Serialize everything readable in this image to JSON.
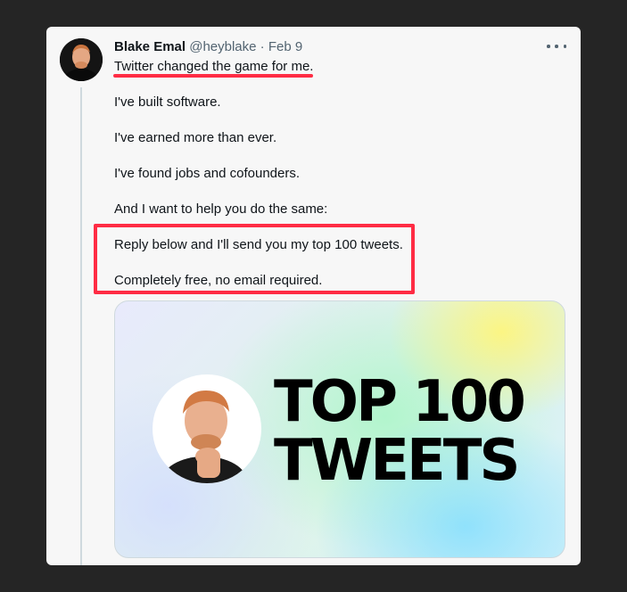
{
  "tweet": {
    "author_name": "Blake Emal",
    "handle": "@heyblake",
    "separator": "·",
    "date": "Feb 9",
    "lines": [
      "Twitter changed the game for me.",
      "I've built software.",
      "I've earned more than ever.",
      "I've found jobs and cofounders.",
      "And I want to help you do the same:",
      "Reply below and I'll send you my top 100 tweets.",
      "Completely free, no email required."
    ]
  },
  "media": {
    "title_line1": "TOP 100",
    "title_line2": "TWEETS"
  },
  "icons": {
    "more": "more-horizontal-icon"
  },
  "colors": {
    "annotation": "#ff2c44",
    "text": "#0f1419",
    "meta": "#536471",
    "thread_line": "#cfd9de"
  }
}
